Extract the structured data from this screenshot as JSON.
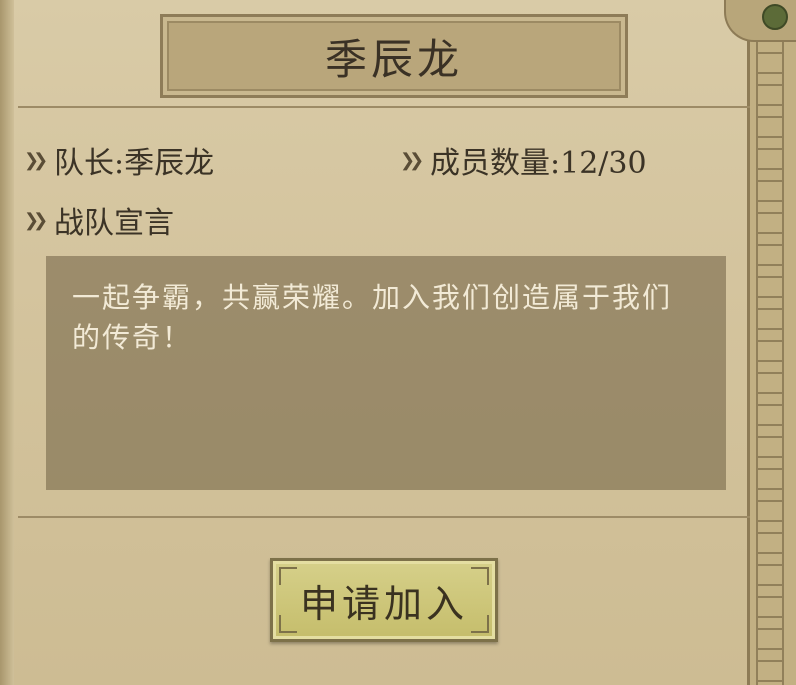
{
  "team": {
    "name": "季辰龙",
    "leader_label": "队长:季辰龙",
    "member_count_label": "成员数量:12/30",
    "declaration_label": "战队宣言",
    "declaration_text": "一起争霸，共赢荣耀。加入我们创造属于我们的传奇！"
  },
  "actions": {
    "join_label": "申请加入"
  },
  "icons": {
    "bullet": "double-chevron-right-icon"
  },
  "colors": {
    "paper": "#d4c49e",
    "declaration_bg": "#7b6e4f",
    "button": "#cfc87b"
  }
}
